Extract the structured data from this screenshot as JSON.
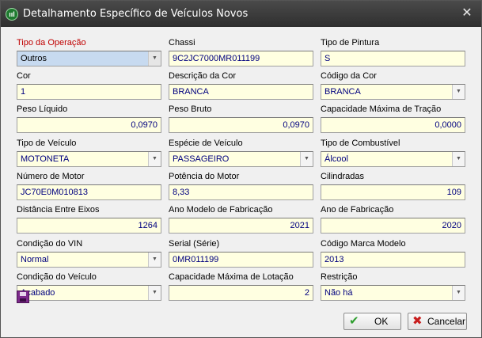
{
  "window": {
    "title": "Detalhamento Específico de Veículos Novos",
    "app_icon_text": "ııl"
  },
  "fields": {
    "tipo_operacao": {
      "label": "Tipo da Operação",
      "value": "Outros"
    },
    "chassi": {
      "label": "Chassi",
      "value": "9C2JC7000MR011199"
    },
    "tipo_pintura": {
      "label": "Tipo de Pintura",
      "value": "S"
    },
    "cor": {
      "label": "Cor",
      "value": "1"
    },
    "descricao_cor": {
      "label": "Descrição da Cor",
      "value": "BRANCA"
    },
    "codigo_cor": {
      "label": "Código da Cor",
      "value": "BRANCA"
    },
    "peso_liquido": {
      "label": "Peso Líquido",
      "value": "0,0970"
    },
    "peso_bruto": {
      "label": "Peso Bruto",
      "value": "0,0970"
    },
    "capacidade_tracao": {
      "label": "Capacidade Máxima de Tração",
      "value": "0,0000"
    },
    "tipo_veiculo": {
      "label": "Tipo de Veículo",
      "value": "MOTONETA"
    },
    "especie_veiculo": {
      "label": "Espécie de Veículo",
      "value": "PASSAGEIRO"
    },
    "tipo_combustivel": {
      "label": "Tipo de Combustível",
      "value": "Álcool"
    },
    "numero_motor": {
      "label": "Número de Motor",
      "value": "JC70E0M010813"
    },
    "potencia_motor": {
      "label": "Potência do Motor",
      "value": "8,33"
    },
    "cilindradas": {
      "label": "Cilindradas",
      "value": "109"
    },
    "distancia_eixos": {
      "label": "Distância Entre Eixos",
      "value": "1264"
    },
    "ano_modelo": {
      "label": "Ano Modelo de Fabricação",
      "value": "2021"
    },
    "ano_fabricacao": {
      "label": "Ano de Fabricação",
      "value": "2020"
    },
    "condicao_vin": {
      "label": "Condição do VIN",
      "value": "Normal"
    },
    "serial": {
      "label": "Serial (Série)",
      "value": "0MR011199"
    },
    "codigo_marca_modelo": {
      "label": "Código Marca Modelo",
      "value": "2013"
    },
    "condicao_veiculo": {
      "label": "Condição do Veículo",
      "value": "Acabado"
    },
    "capacidade_lotacao": {
      "label": "Capacidade Máxima de Lotação",
      "value": "2"
    },
    "restricao": {
      "label": "Restrição",
      "value": "Não há"
    }
  },
  "buttons": {
    "ok": {
      "label": "OK",
      "icon": "check-icon"
    },
    "cancel": {
      "label": "Cancelar",
      "icon": "x-icon"
    }
  },
  "footer": {
    "save_icon": "floppy-disk-icon"
  },
  "colors": {
    "field_background": "#ffffe1",
    "field_text": "#00007f",
    "required_label": "#c00000",
    "titlebar": "#3a3a3a"
  }
}
